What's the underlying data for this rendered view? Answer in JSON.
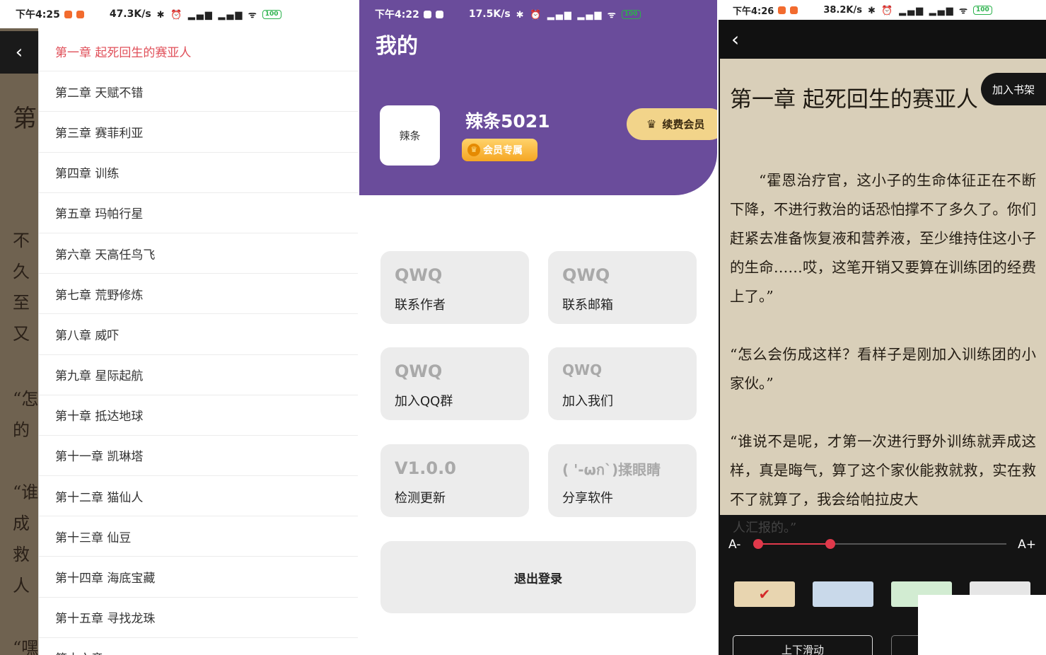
{
  "panel1": {
    "status": {
      "time": "下午4:25",
      "net": "47.3K/s",
      "icons": "✱ ⏰ ▂▄▆ ▂▄▆ ᯤ",
      "battery": "100"
    },
    "reader_fragments": {
      "heading": "第",
      "lines": [
        "不",
        "久",
        "至",
        "又",
        "“怎",
        "的",
        "“谁",
        "成",
        "救",
        "人",
        "“嘿"
      ]
    },
    "toc": [
      "第一章 起死回生的赛亚人",
      "第二章 天赋不错",
      "第三章 赛菲利亚",
      "第四章 训练",
      "第五章 玛帕行星",
      "第六章 天高任鸟飞",
      "第七章 荒野修炼",
      "第八章 威吓",
      "第九章 星际起航",
      "第十章 抵达地球",
      "第十一章 凯琳塔",
      "第十二章 猫仙人",
      "第十三章 仙豆",
      "第十四章 海底宝藏",
      "第十五章 寻找龙珠",
      "第十六章 ..."
    ]
  },
  "panel2": {
    "status": {
      "time": "下午4:22",
      "net": "17.5K/s",
      "icons": "✱ ⏰ ▂▄▆ ▂▄▆ ᯤ",
      "battery": "100"
    },
    "title": "我的",
    "avatar_text": "辣条",
    "username": "辣条5021",
    "vip_badge": "会员专属",
    "renew_label": "续费会员",
    "cards": [
      {
        "big": "QWQ",
        "label": "联系作者"
      },
      {
        "big": "QWQ",
        "label": "联系邮箱"
      },
      {
        "big": "QWQ",
        "label": "加入QQ群"
      },
      {
        "big": "QWQ",
        "label": "加入我们"
      },
      {
        "big": "V1.0.0",
        "label": "检测更新"
      },
      {
        "big": "( '-ωก`)揉眼睛",
        "label": "分享软件"
      }
    ],
    "logout_label": "退出登录",
    "colors": {
      "header": "#6a4c9b",
      "card": "#ececec"
    }
  },
  "panel3": {
    "status": {
      "time": "下午4:26",
      "net": "38.2K/s",
      "icons": "✱ ⏰ ▂▄▆ ▂▄▆ ᯤ",
      "battery": "100"
    },
    "back_icon": "‹",
    "chapter_title": "第一章 起死回生的赛亚人",
    "add_shelf": "加入书架",
    "paragraphs": [
      "“霍恩治疗官，这小子的生命体征正在不断下降，不进行救治的话恐怕撑不了多久了。你们赶紧去准备恢复液和营养液，至少维持住这小子的生命……哎，这笔开销又要算在训练团的经费上了。”",
      "“怎么会伤成这样？看样子是刚加入训练团的小家伙。”",
      "“谁说不是呢，才第一次进行野外训练就弄成这样，真是晦气，算了这个家伙能救就救，实在救不了就算了，我会给帕拉皮大"
    ],
    "peek_text": "人汇报的。”",
    "font_minus": "A-",
    "font_plus": "A+",
    "font_size_level": 0.29,
    "swatches": [
      "#e8d5b0",
      "#c9d9ea",
      "#d2ecd2",
      "#e6e6e6"
    ],
    "scroll_mode": "上下滑动"
  }
}
